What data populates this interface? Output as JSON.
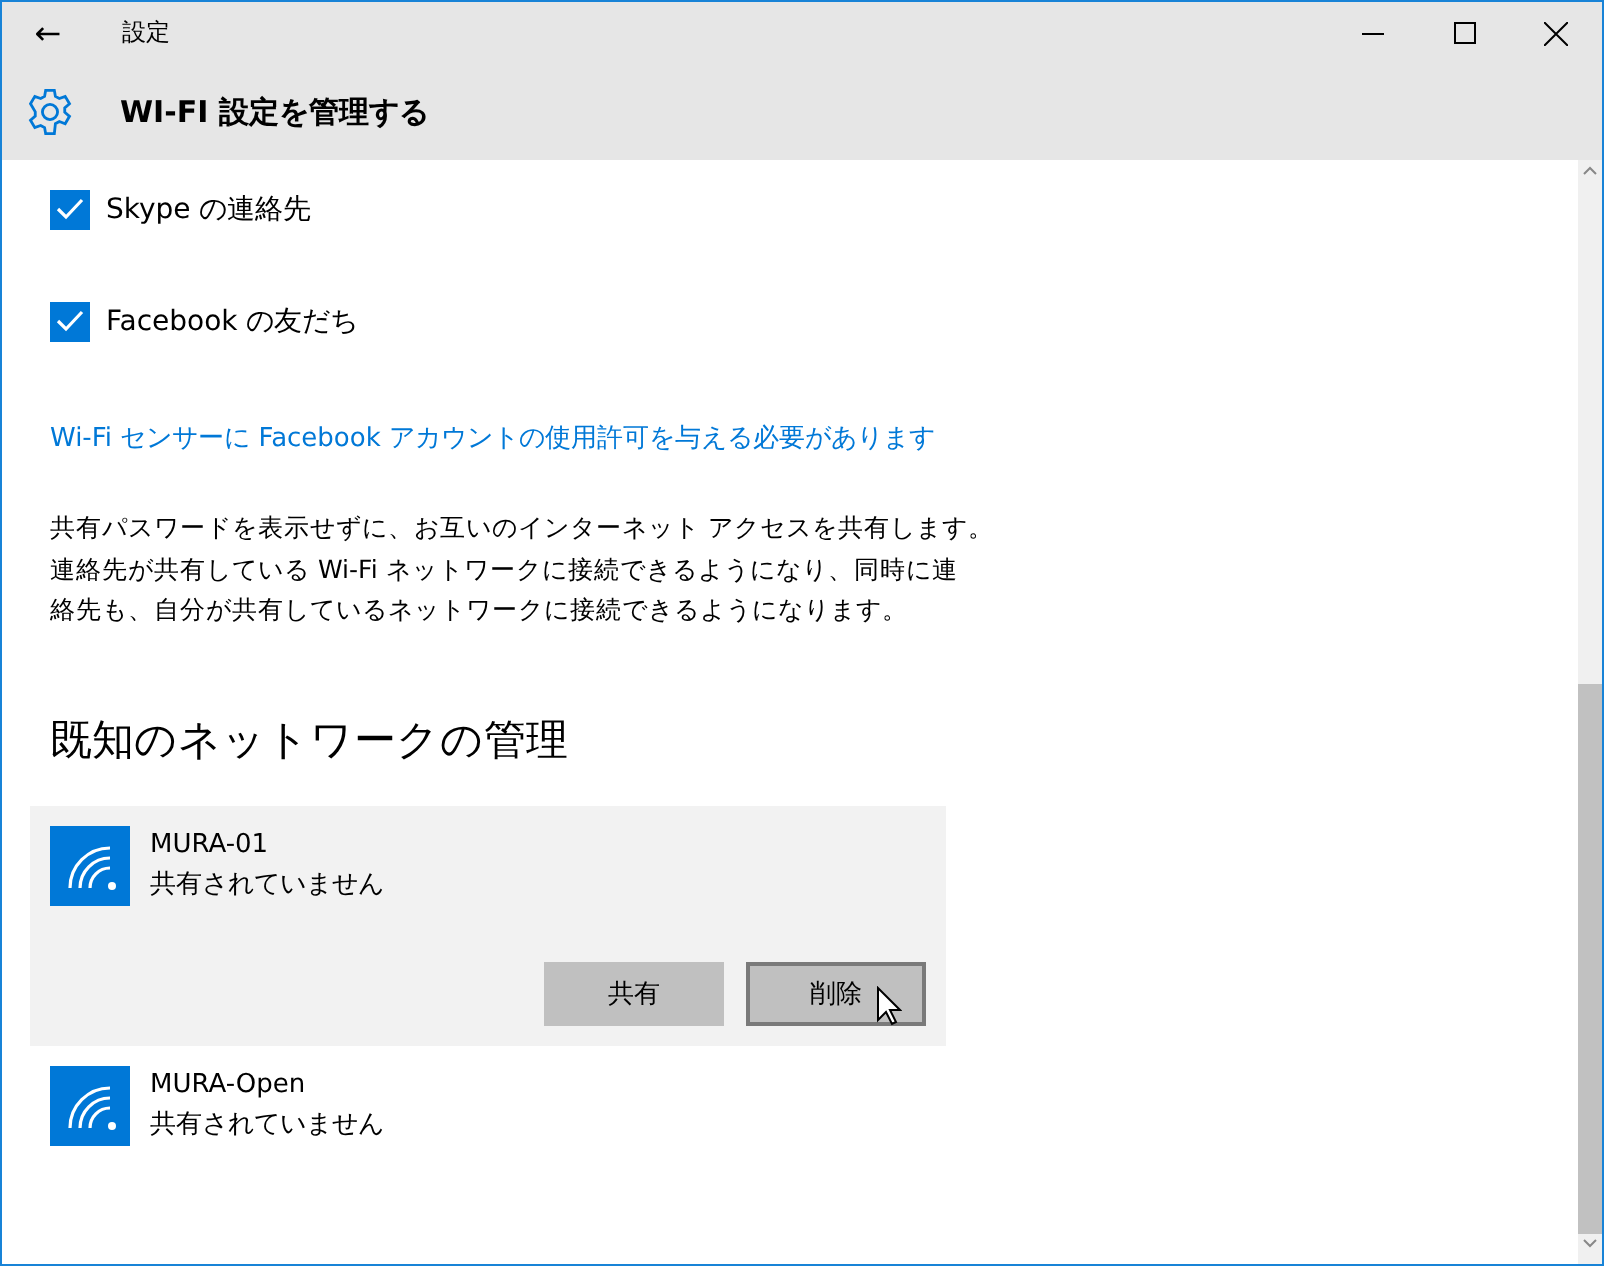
{
  "window": {
    "title": "設定",
    "back": "←"
  },
  "header": {
    "title": "WI-FI 設定を管理する"
  },
  "checkboxes": [
    {
      "label": "Skype の連絡先",
      "checked": true
    },
    {
      "label": "Facebook の友だち",
      "checked": true
    }
  ],
  "link": "Wi-Fi センサーに Facebook アカウントの使用許可を与える必要があります",
  "description": [
    "共有パスワードを表示せずに、お互いのインターネット アクセスを共有します。",
    "連絡先が共有している Wi-Fi ネットワークに接続できるようになり、同時に連",
    "絡先も、自分が共有しているネットワークに接続できるようになります。"
  ],
  "section_title": "既知のネットワークの管理",
  "networks": [
    {
      "name": "MURA-01",
      "status": "共有されていません",
      "expanded": true,
      "buttons": [
        {
          "label": "共有",
          "hovered": false
        },
        {
          "label": "削除",
          "hovered": true
        }
      ]
    },
    {
      "name": "MURA-Open",
      "status": "共有されていません",
      "expanded": false
    }
  ]
}
